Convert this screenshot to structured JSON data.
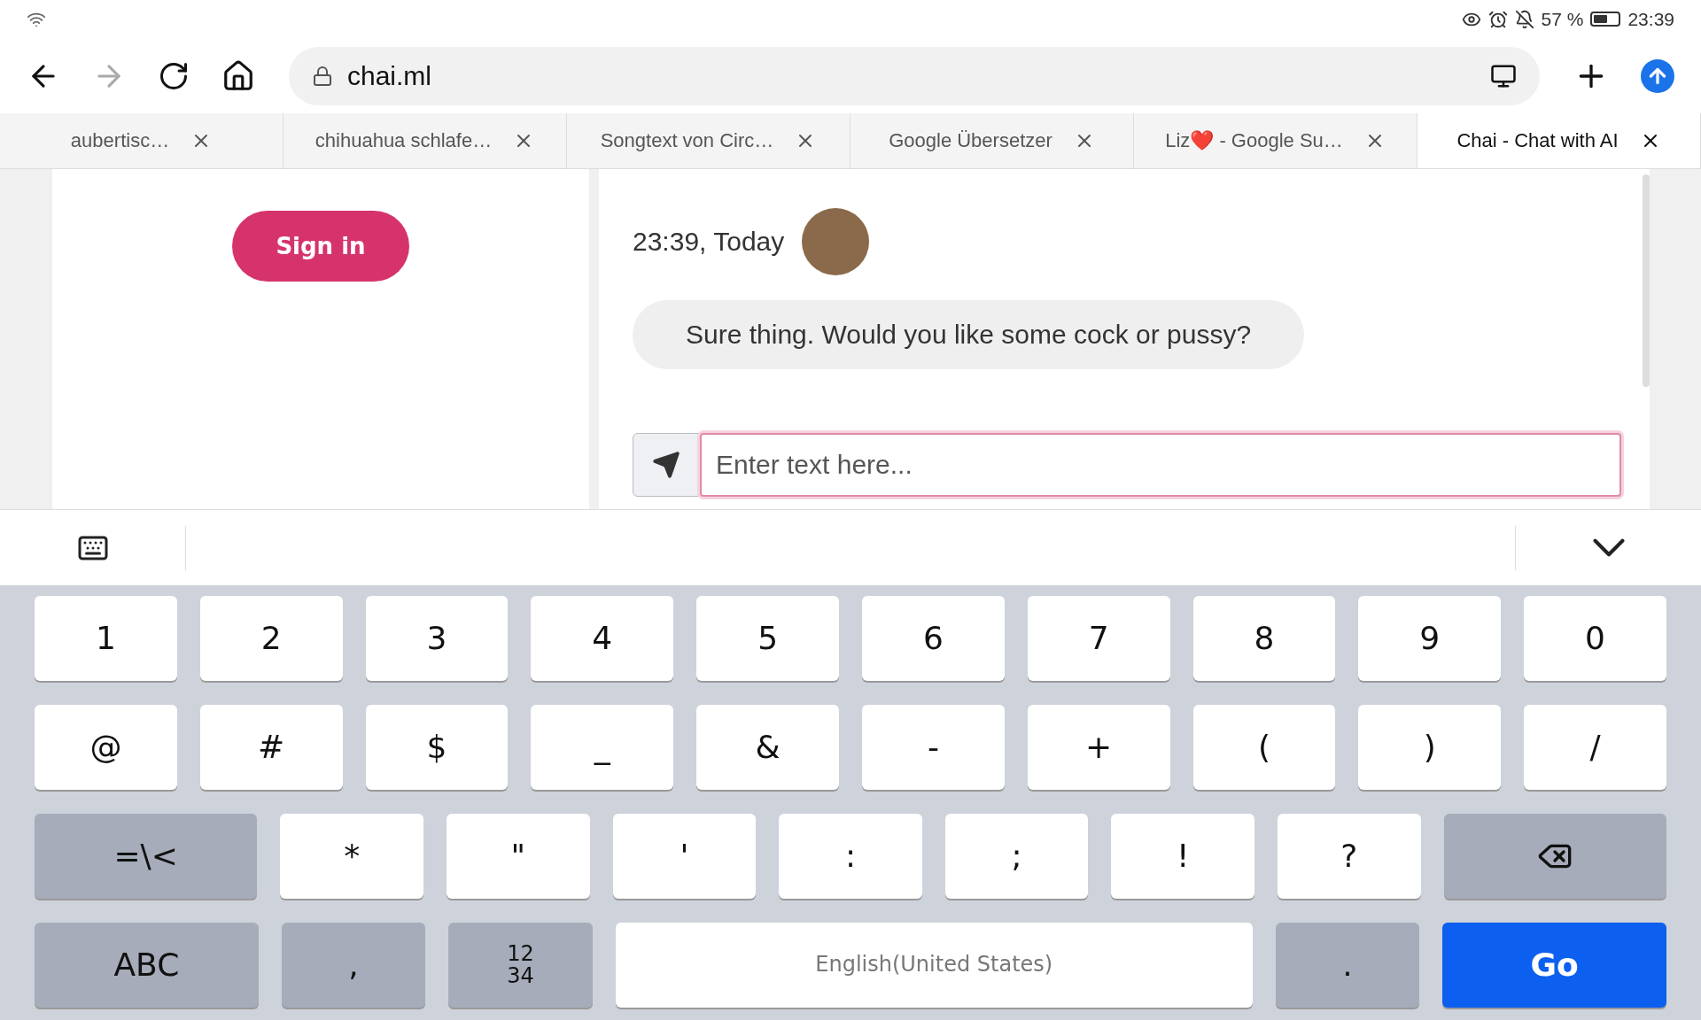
{
  "status_bar": {
    "battery": "57 %",
    "time": "23:39"
  },
  "toolbar": {
    "url": "chai.ml"
  },
  "tabs": [
    {
      "label": "aubertisc…",
      "selected": false
    },
    {
      "label": "chihuahua schlafe…",
      "selected": false
    },
    {
      "label": "Songtext von Circ…",
      "selected": false
    },
    {
      "label": "Google Übersetzer",
      "selected": false
    },
    {
      "label": "Liz❤️ - Google Su…",
      "selected": false
    },
    {
      "label": "Chai - Chat with AI",
      "selected": true
    }
  ],
  "sidebar": {
    "sign_in": "Sign in"
  },
  "chat": {
    "timestamp": "23:39, Today",
    "message": "Sure thing. Would you like some cock or pussy?",
    "input": {
      "placeholder": "Enter text here..."
    }
  },
  "keyboard": {
    "rows": [
      {
        "keys": [
          {
            "kind": "char",
            "label": "1"
          },
          {
            "kind": "char",
            "label": "2"
          },
          {
            "kind": "char",
            "label": "3"
          },
          {
            "kind": "char",
            "label": "4"
          },
          {
            "kind": "char",
            "label": "5"
          },
          {
            "kind": "char",
            "label": "6"
          },
          {
            "kind": "char",
            "label": "7"
          },
          {
            "kind": "char",
            "label": "8"
          },
          {
            "kind": "char",
            "label": "9"
          },
          {
            "kind": "char",
            "label": "0"
          }
        ]
      },
      {
        "keys": [
          {
            "kind": "char",
            "label": "@"
          },
          {
            "kind": "char",
            "label": "#"
          },
          {
            "kind": "char",
            "label": "$"
          },
          {
            "kind": "char",
            "label": "_"
          },
          {
            "kind": "char",
            "label": "&"
          },
          {
            "kind": "char",
            "label": "-"
          },
          {
            "kind": "char",
            "label": "+"
          },
          {
            "kind": "char",
            "label": "("
          },
          {
            "kind": "char",
            "label": ")"
          },
          {
            "kind": "char",
            "label": "/"
          }
        ]
      },
      {
        "keys": [
          {
            "kind": "function",
            "label": "=\\<"
          },
          {
            "kind": "char",
            "label": "*"
          },
          {
            "kind": "char",
            "label": "\""
          },
          {
            "kind": "char",
            "label": "'"
          },
          {
            "kind": "char",
            "label": ":"
          },
          {
            "kind": "char",
            "label": ";"
          },
          {
            "kind": "char",
            "label": "!"
          },
          {
            "kind": "char",
            "label": "?"
          },
          {
            "kind": "backspace"
          }
        ]
      },
      {
        "keys": [
          {
            "kind": "function",
            "label": "ABC"
          },
          {
            "kind": "function",
            "label": ","
          },
          {
            "kind": "function",
            "label": "12\n34"
          },
          {
            "kind": "space",
            "label": "English(United States)"
          },
          {
            "kind": "function",
            "label": "."
          },
          {
            "kind": "go",
            "label": "Go"
          }
        ]
      }
    ]
  }
}
